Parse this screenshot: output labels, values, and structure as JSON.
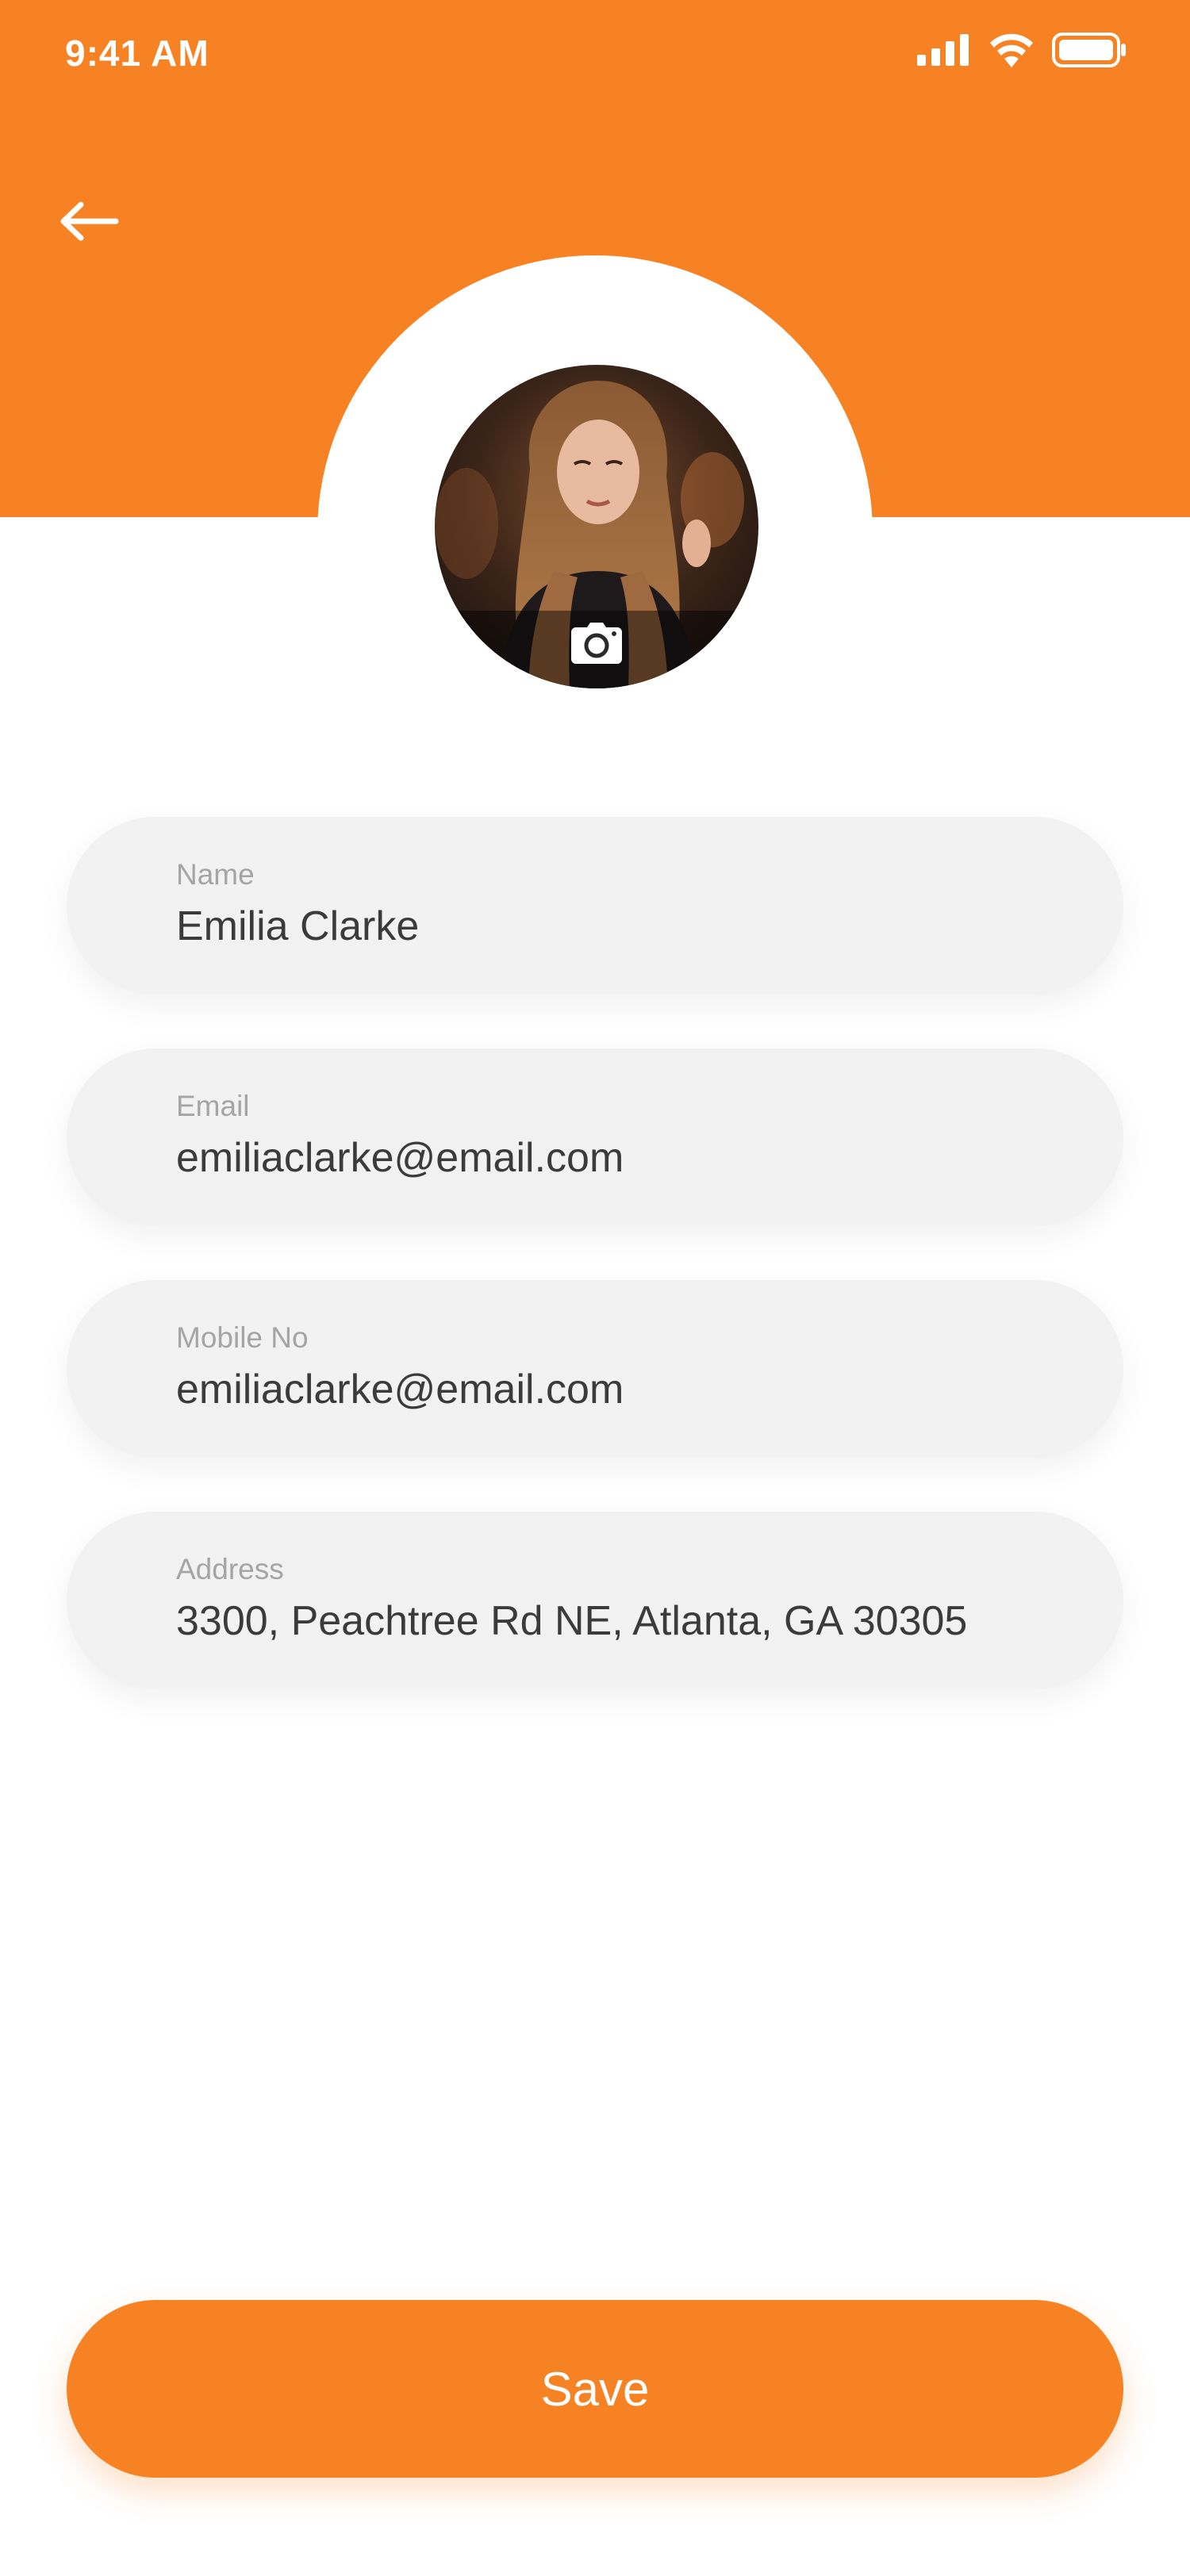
{
  "status_bar": {
    "time": "9:41 AM",
    "icons": [
      "signal-icon",
      "wifi-icon",
      "battery-icon"
    ]
  },
  "header": {
    "back_icon": "arrow-left-icon",
    "background_color": "#f68224"
  },
  "profile": {
    "avatar_icon": "camera-icon"
  },
  "form": {
    "fields": [
      {
        "label": "Name",
        "value": "Emilia Clarke"
      },
      {
        "label": "Email",
        "value": "emiliaclarke@email.com"
      },
      {
        "label": "Mobile No",
        "value": "emiliaclarke@email.com"
      },
      {
        "label": "Address",
        "value": "3300, Peachtree Rd NE, Atlanta, GA 30305"
      }
    ]
  },
  "actions": {
    "save_label": "Save",
    "accent_color": "#f68224"
  }
}
